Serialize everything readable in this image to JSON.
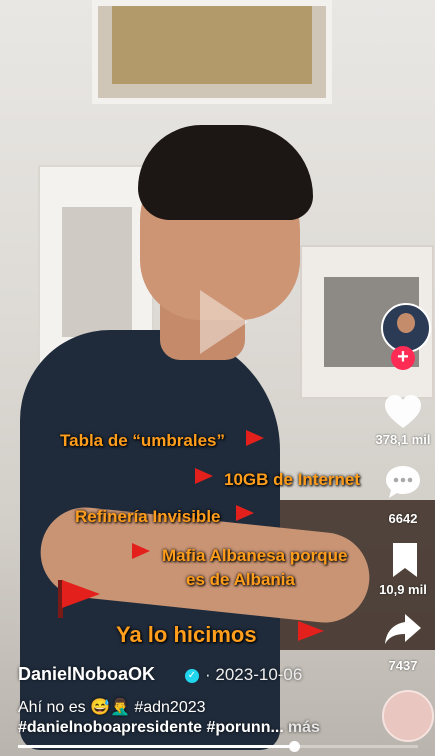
{
  "video": {
    "annotations": [
      "Tabla de “umbrales”",
      "10GB de Internet",
      "Refinería Invisible",
      "Mafia Albanesa porque",
      "es de Albania",
      "Ya lo hicimos"
    ]
  },
  "rail": {
    "likes": "378,1 mil",
    "comments": "6642",
    "saves": "10,9 mil",
    "shares": "7437"
  },
  "meta": {
    "username": "DanielNoboaOK",
    "date": "· 2023-10-06",
    "caption_line1": "Ahí no es 😅🤦‍♂️ #adn2023",
    "caption_line2": "#danielnoboapresidente #porunn...",
    "more_label": "más"
  },
  "progress": {
    "fraction": 0.69
  },
  "colors": {
    "accent": "#ff9d1c",
    "flag": "#e3201b",
    "follow": "#fe2c55"
  },
  "icons": [
    "play-icon",
    "heart-icon",
    "comment-icon",
    "bookmark-icon",
    "share-icon",
    "verified-icon",
    "plus-icon"
  ]
}
